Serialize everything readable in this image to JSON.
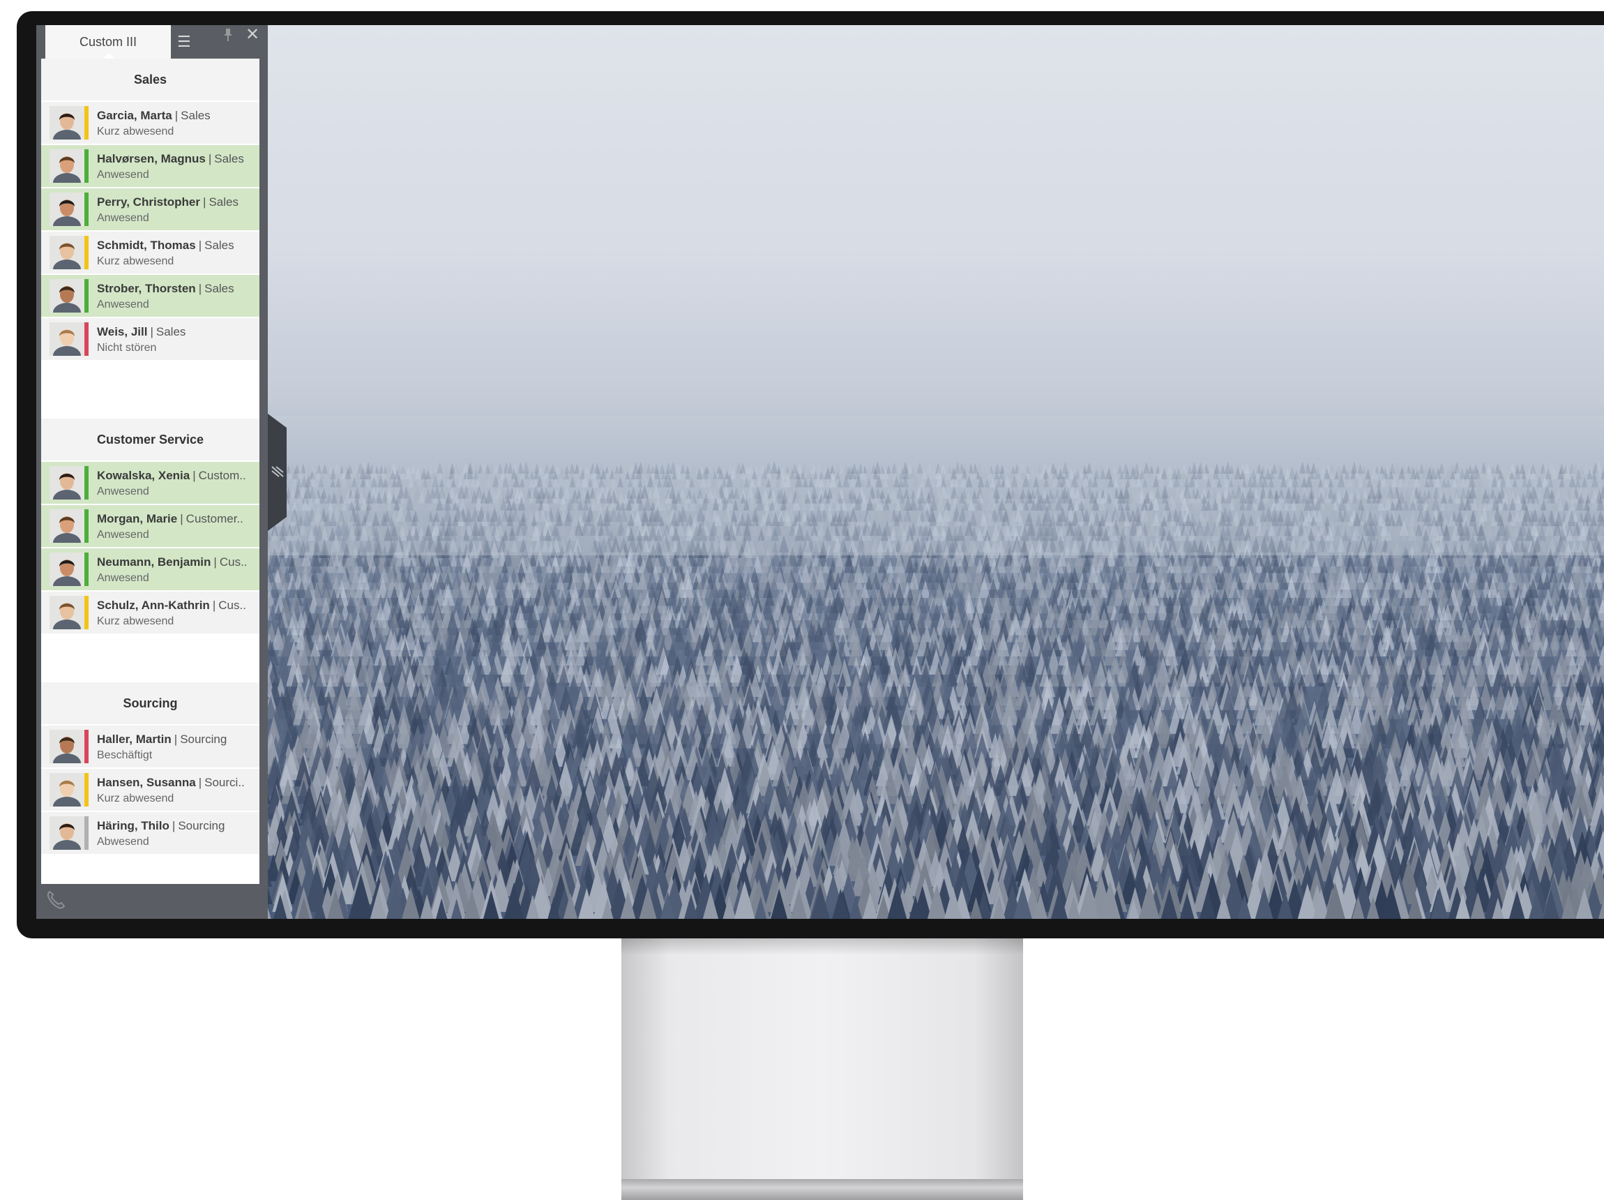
{
  "panel": {
    "tab_label": "Custom III",
    "menu_icon": "hamburger-menu-icon",
    "pin_icon": "pin-icon",
    "close_icon": "close-icon",
    "footer_icon": "phone-icon",
    "collapse_icon": "collapse-panel-icon"
  },
  "status_colors": {
    "available": "#4caf3a",
    "away": "#f2c417",
    "dnd": "#d9455a",
    "busy": "#d9455a",
    "offline": "#b0b0b0"
  },
  "groups": [
    {
      "title": "Sales",
      "contacts": [
        {
          "name": "Garcia, Marta",
          "dept": "Sales",
          "status": "Kurz abwesend"
        },
        {
          "name": "Halvørsen, Magnus",
          "dept": "Sales",
          "status": "Anwesend"
        },
        {
          "name": "Perry, Christopher",
          "dept": "Sales",
          "status": "Anwesend"
        },
        {
          "name": "Schmidt, Thomas",
          "dept": "Sales",
          "status": "Kurz abwesend"
        },
        {
          "name": "Strober, Thorsten",
          "dept": "Sales",
          "status": "Anwesend"
        },
        {
          "name": "Weis, Jill",
          "dept": "Sales",
          "status": "Nicht stören"
        }
      ]
    },
    {
      "title": "Customer Service",
      "contacts": [
        {
          "name": "Kowalska, Xenia",
          "dept": "Custom..",
          "status": "Anwesend"
        },
        {
          "name": "Morgan, Marie",
          "dept": "Customer..",
          "status": "Anwesend"
        },
        {
          "name": "Neumann, Benjamin",
          "dept": "Cus..",
          "status": "Anwesend"
        },
        {
          "name": "Schulz, Ann-Kathrin",
          "dept": "Cus..",
          "status": "Kurz abwesend"
        }
      ]
    },
    {
      "title": "Sourcing",
      "contacts": [
        {
          "name": "Haller, Martin",
          "dept": "Sourcing",
          "status": "Beschäftigt"
        },
        {
          "name": "Hansen, Susanna",
          "dept": "Sourci..",
          "status": "Kurz abwesend"
        },
        {
          "name": "Häring, Thilo",
          "dept": "Sourcing",
          "status": "Abwesend"
        }
      ]
    }
  ]
}
